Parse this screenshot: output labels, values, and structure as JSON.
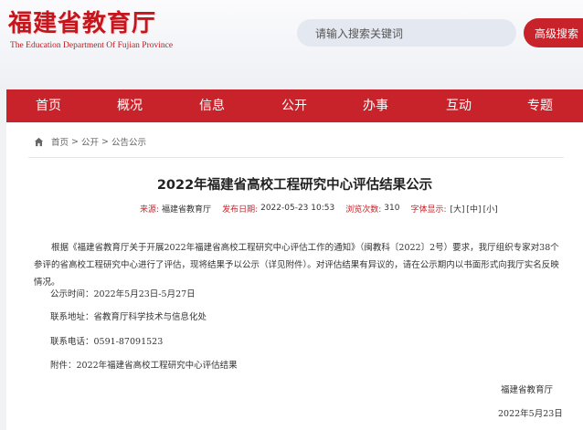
{
  "header": {
    "logo_title": "福建省教育厅",
    "logo_subtitle": "The Education Department Of Fujian Province",
    "search_placeholder": "请输入搜索关键词",
    "advanced_search": "高级搜索"
  },
  "nav": {
    "items": [
      "首页",
      "概况",
      "信息",
      "公开",
      "办事",
      "互动",
      "专题"
    ]
  },
  "breadcrumb": {
    "items": [
      "首页",
      "公开",
      "公告公示"
    ],
    "separator": ">"
  },
  "article": {
    "title": "2022年福建省高校工程研究中心评估结果公示",
    "source_label": "来源:",
    "source": "福建省教育厅",
    "date_label": "发布日期:",
    "date": "2022-05-23 10:53",
    "views_label": "浏览次数:",
    "views": "310",
    "font_label": "字体显示:",
    "font_large": "[大]",
    "font_medium": "[中]",
    "font_small": "[小]",
    "paragraph": "根据《福建省教育厅关于开展2022年福建省高校工程研究中心评估工作的通知》（闽教科〔2022〕2号）要求，我厅组织专家对38个参评的省高校工程研究中心进行了评估，现将结果予以公示（详见附件）。对评估结果有异议的，请在公示期内以书面形式向我厅实名反映情况。",
    "period": "公示时间：2022年5月23日-5月27日",
    "address": "联系地址：省教育厅科学技术与信息化处",
    "phone": "联系电话：0591-87091523",
    "attachment": "附件：2022年福建省高校工程研究中心评估结果",
    "signature": "福建省教育厅",
    "sign_date": "2022年5月23日"
  },
  "colors": {
    "brand_red": "#c8222a",
    "background": "#f1f2f4"
  }
}
